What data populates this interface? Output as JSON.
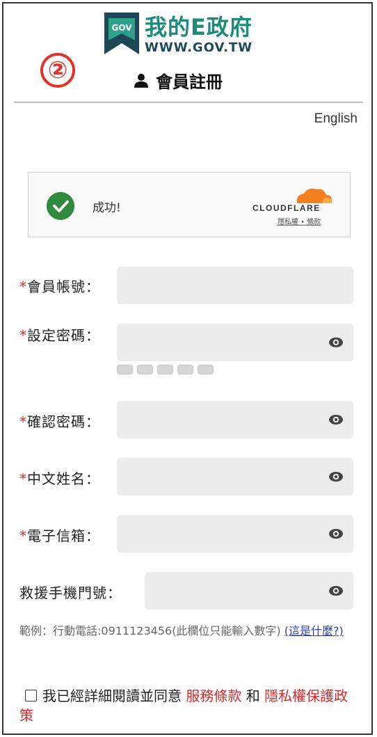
{
  "header": {
    "logo_text": "我的E政府",
    "logo_url": "WWW.GOV.TW",
    "logo_badge": "GOV",
    "step_number": "②",
    "title": "會員註冊",
    "language_link": "English"
  },
  "captcha": {
    "status_text": "成功!",
    "brand": "CLOUDFLARE",
    "links": "隱私權 • 條款"
  },
  "form": {
    "required_mark": "*",
    "fields": [
      {
        "label": "會員帳號：",
        "value": ""
      },
      {
        "label": "設定密碼：",
        "value": ""
      },
      {
        "label": "確認密碼：",
        "value": ""
      },
      {
        "label": "中文姓名：",
        "value": ""
      },
      {
        "label": "電子信箱：",
        "value": ""
      },
      {
        "label": "救援手機門號：",
        "value": ""
      }
    ],
    "password_strength_level": 0,
    "hint": "範例：行動電話:0911123456(此欄位只能輸入數字)",
    "hint_link": "(這是什麼?)"
  },
  "agreement": {
    "prefix": "我已經詳細閱讀並同意",
    "terms_link": "服務條款",
    "conjunction": "和",
    "privacy_link": "隱私權保護政策"
  },
  "colors": {
    "required": "#d42a2a",
    "logo_green": "#1d8a7a",
    "success_green": "#2f8a3e",
    "cloudflare_orange": "#f38020"
  }
}
